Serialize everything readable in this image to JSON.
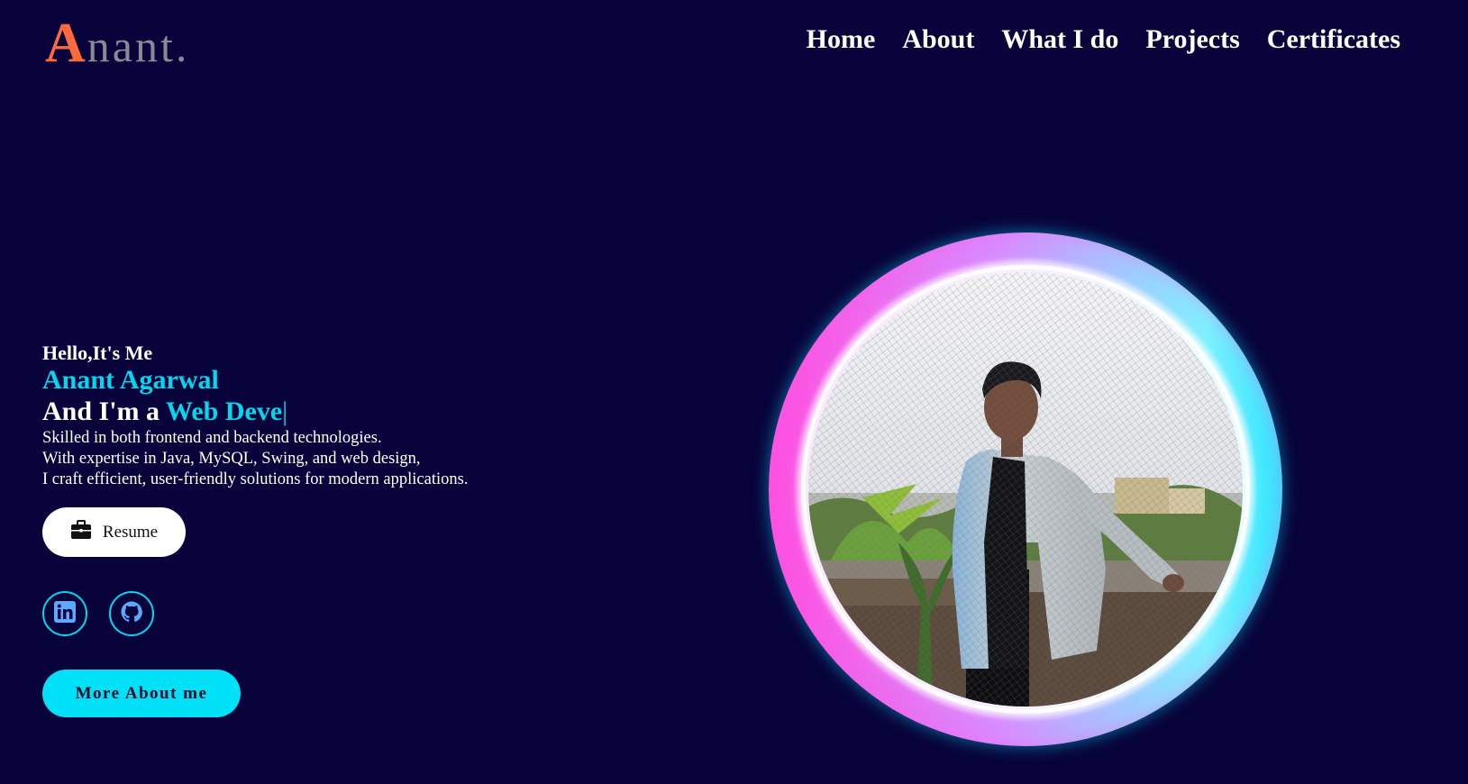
{
  "logo": {
    "initial": "A",
    "rest": "nant."
  },
  "nav": {
    "items": [
      {
        "label": "Home"
      },
      {
        "label": "About"
      },
      {
        "label": "What I do"
      },
      {
        "label": "Projects"
      },
      {
        "label": "Certificates"
      }
    ]
  },
  "hero": {
    "greeting": "Hello,It's Me",
    "name": "Anant Agarwal",
    "role_prefix": "And I'm a ",
    "role_typed": "Web Deve",
    "cursor": "|",
    "description": [
      "Skilled in both frontend and backend technologies.",
      "With expertise in Java, MySQL, Swing, and web design,",
      "I craft efficient, user-friendly solutions for modern applications."
    ]
  },
  "buttons": {
    "resume_label": "Resume",
    "more_label": "More About me"
  },
  "socials": [
    {
      "icon": "linkedin-icon"
    },
    {
      "icon": "github-icon"
    }
  ],
  "colors": {
    "background": "#08033a",
    "accent": "#00d8f0",
    "logo_accent": "#ff6a3d"
  }
}
